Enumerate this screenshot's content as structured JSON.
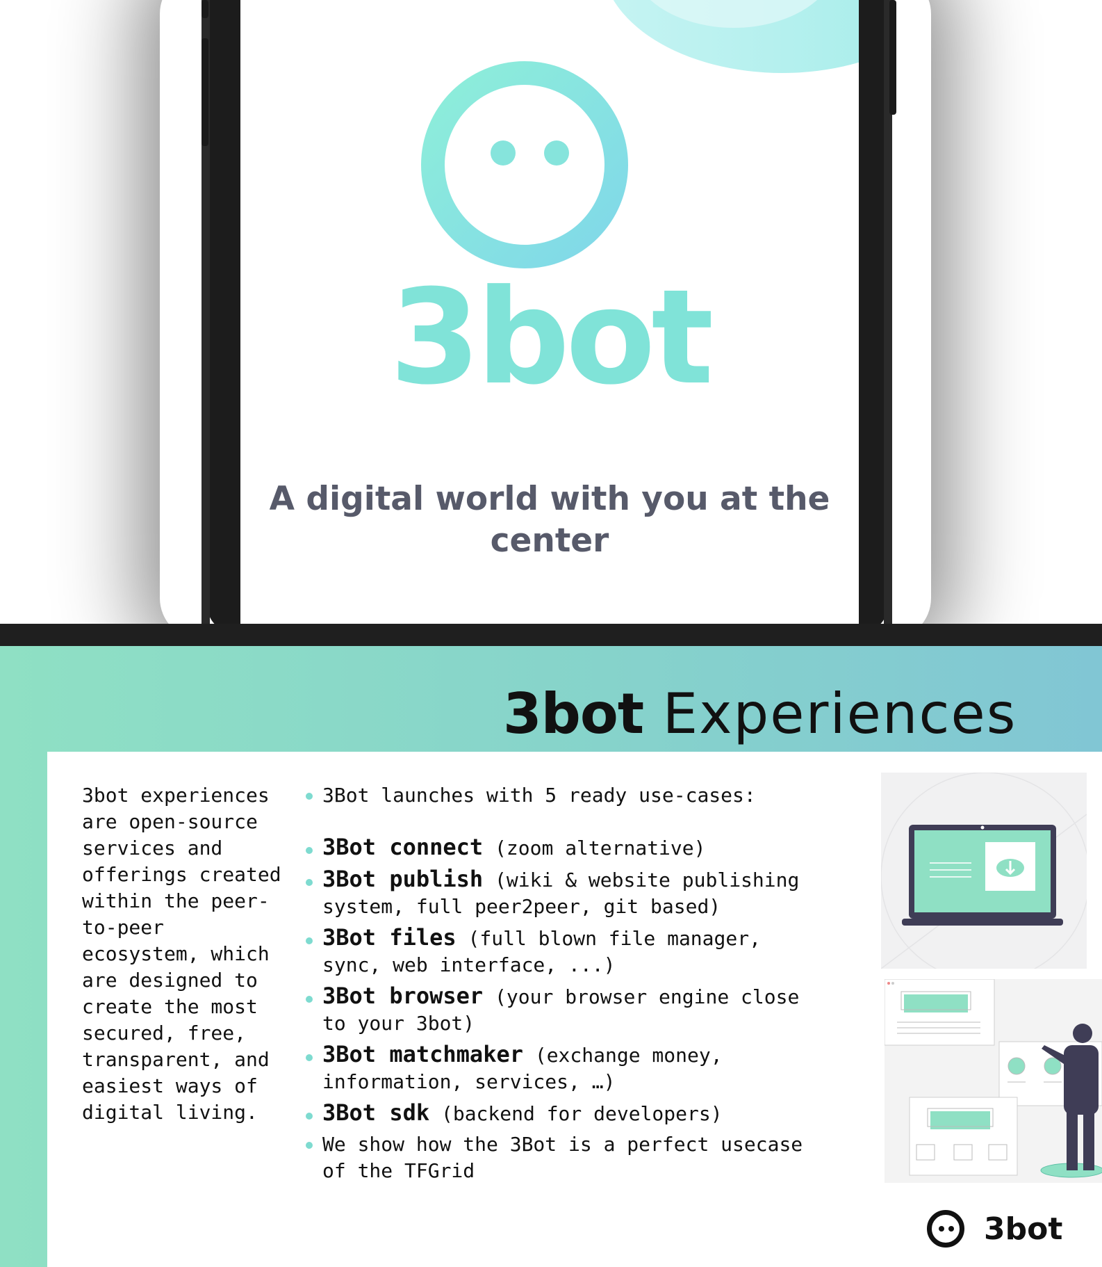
{
  "hero": {
    "app_name": "3bot",
    "tagline": "A digital world with you at the center"
  },
  "slide": {
    "title_bold": "3bot",
    "title_rest": "Experiences",
    "intro": "3bot experiences are open-source services and offerings created within the peer-to-peer ecosystem, which are designed to create the most secured, free, transparent, and easiest ways of digital living.",
    "lead": "3Bot launches with 5 ready use-cases:",
    "items": [
      {
        "name": "3Bot connect",
        "desc": "(zoom alternative)"
      },
      {
        "name": "3Bot publish",
        "desc": " (wiki & website publishing system, full peer2peer, git based)"
      },
      {
        "name": "3Bot files",
        "desc": "(full blown file manager, sync, web interface, ...)"
      },
      {
        "name": "3Bot browser",
        "desc": "(your browser engine close to your 3bot)"
      },
      {
        "name": "3Bot matchmaker",
        "desc": "(exchange money, information, services, …)"
      },
      {
        "name": "3Bot sdk",
        "desc": "(backend for developers)"
      }
    ],
    "closing": "We show how the 3Bot is a perfect usecase of the TFGrid",
    "brand": "3bot"
  },
  "colors": {
    "accent": "#80e3d8",
    "gradient_start": "#8fe0c4",
    "gradient_end": "#81c6d4",
    "text_dark": "#111111",
    "tagline_gray": "#575a6a",
    "divider": "#1f1f1f"
  },
  "icons": [
    "3bot-logo-icon",
    "laptop-download-illustration",
    "person-wireframes-illustration",
    "3bot-brand-icon"
  ]
}
